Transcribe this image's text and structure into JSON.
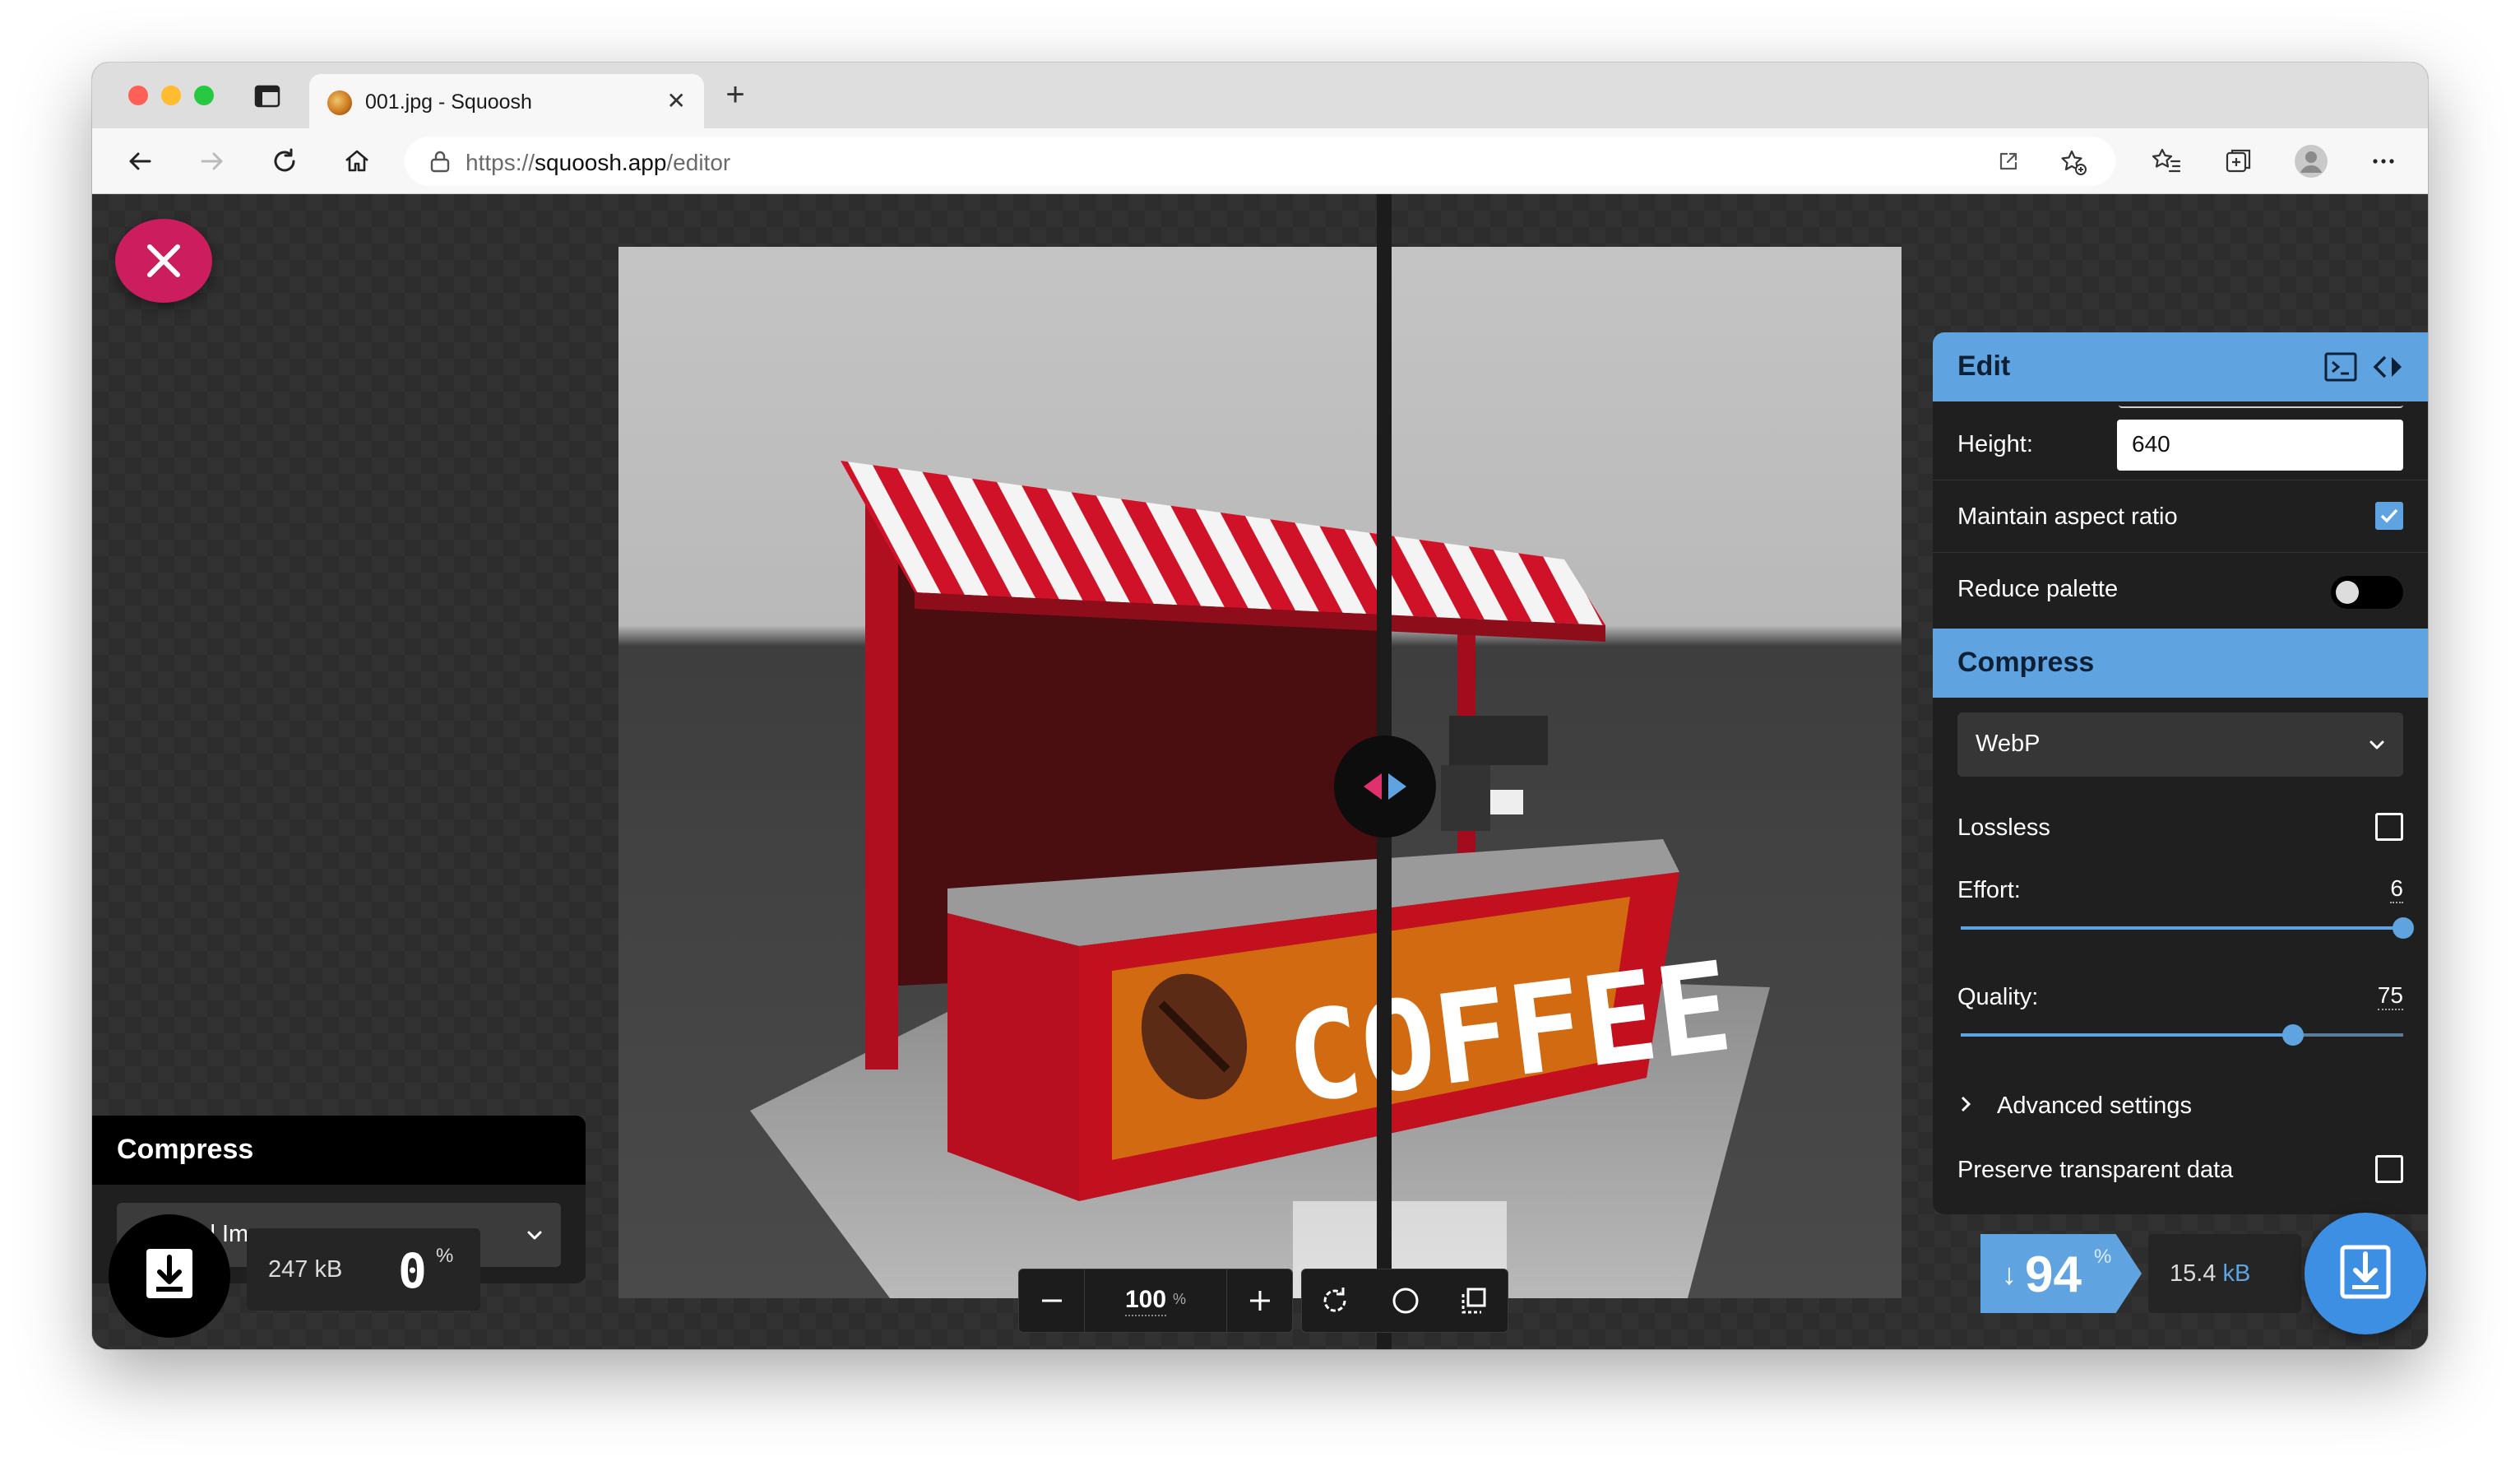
{
  "browser": {
    "tab_title": "001.jpg - Squoosh",
    "url_prefix": "https://",
    "url_host": "squoosh.app",
    "url_path": "/editor"
  },
  "left_panel": {
    "title": "Compress",
    "selected_option": "Original Image",
    "size": "247 kB",
    "percent": "0",
    "percent_sign": "%"
  },
  "zoom": {
    "value": "100",
    "unit": "%"
  },
  "right_panel": {
    "edit_title": "Edit",
    "height_label": "Height:",
    "height_value": "640",
    "maintain_aspect_label": "Maintain aspect ratio",
    "maintain_aspect_checked": true,
    "reduce_palette_label": "Reduce palette",
    "reduce_palette_on": false,
    "compress_title": "Compress",
    "codec": "WebP",
    "lossless_label": "Lossless",
    "lossless_checked": false,
    "effort_label": "Effort:",
    "effort_value": "6",
    "effort_fraction": 1.0,
    "quality_label": "Quality:",
    "quality_value": "75",
    "quality_fraction": 0.75,
    "advanced_label": "Advanced settings",
    "preserve_label": "Preserve transparent data",
    "preserve_checked": false
  },
  "result": {
    "arrow": "↓",
    "savings": "94",
    "savings_sign": "%",
    "size_number": "15.4",
    "size_unit": "kB"
  },
  "image_text": {
    "sign": "COFFEE"
  },
  "colors": {
    "accent_blue": "#5fa4e0",
    "close_pink": "#cc1d5f",
    "awning_red": "#c8102e"
  }
}
